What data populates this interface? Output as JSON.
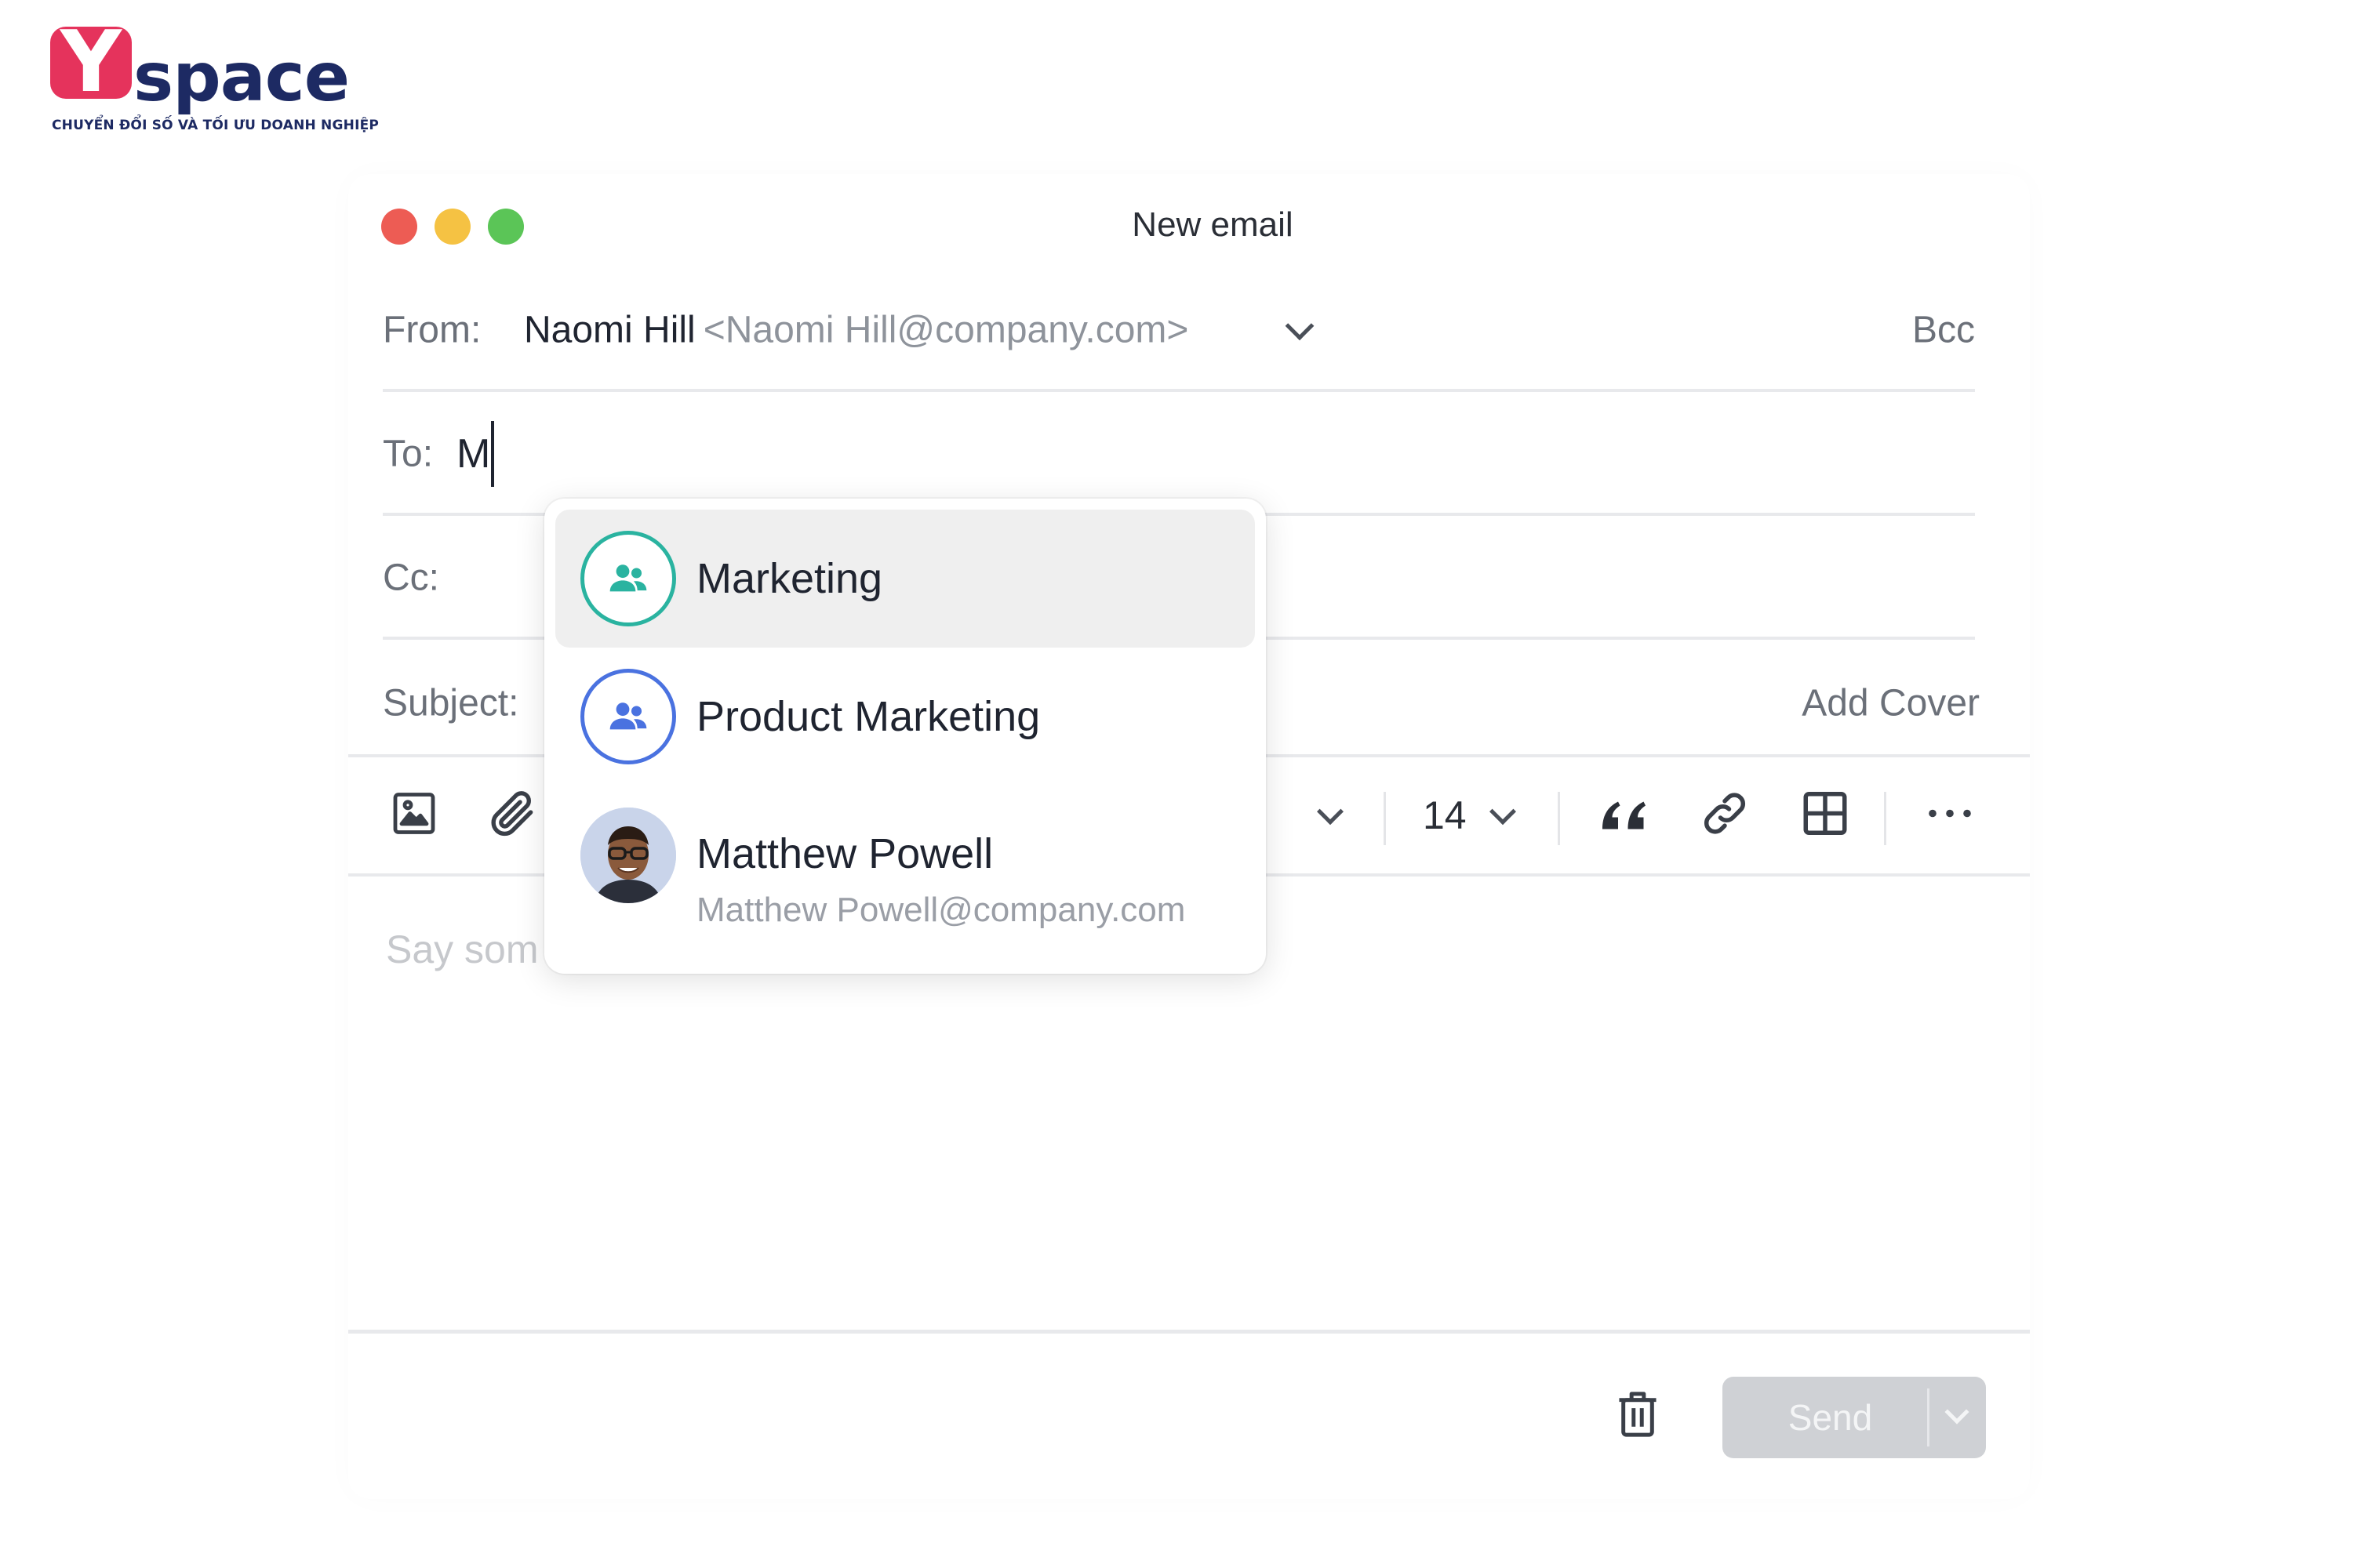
{
  "logo": {
    "mark": "Y",
    "word": "space",
    "tagline": "CHUYỂN ĐỔI SỐ VÀ TỐI ƯU DOANH NGHIỆP"
  },
  "window": {
    "title": "New email"
  },
  "from": {
    "label": "From:",
    "name": "Naomi Hill",
    "address": "<Naomi Hill@company.com>",
    "bcc_label": "Bcc"
  },
  "to": {
    "label": "To:",
    "value": "M"
  },
  "cc": {
    "label": "Cc:"
  },
  "subject": {
    "label": "Subject:",
    "add_cover_label": "Add Cover"
  },
  "toolbar": {
    "font_size": "14",
    "icons": [
      "image-icon",
      "attachment-icon",
      "chevron-down-icon",
      "quote-icon",
      "link-icon",
      "table-icon",
      "more-icon"
    ]
  },
  "body": {
    "placeholder": "Say som"
  },
  "footer": {
    "send_label": "Send"
  },
  "suggestions": [
    {
      "name": "Marketing",
      "kind": "group",
      "accent": "#2ab3a0"
    },
    {
      "name": "Product Marketing",
      "kind": "group",
      "accent": "#4a72e0"
    },
    {
      "name": "Matthew Powell",
      "email": "Matthew Powell@company.com",
      "kind": "person"
    }
  ],
  "colors": {
    "logo_pink": "#e5335c",
    "logo_navy": "#1d2a63",
    "close": "#ed5c54",
    "minimize": "#f5c243",
    "maximize": "#5bc557",
    "send_disabled": "#cfd1d5"
  }
}
